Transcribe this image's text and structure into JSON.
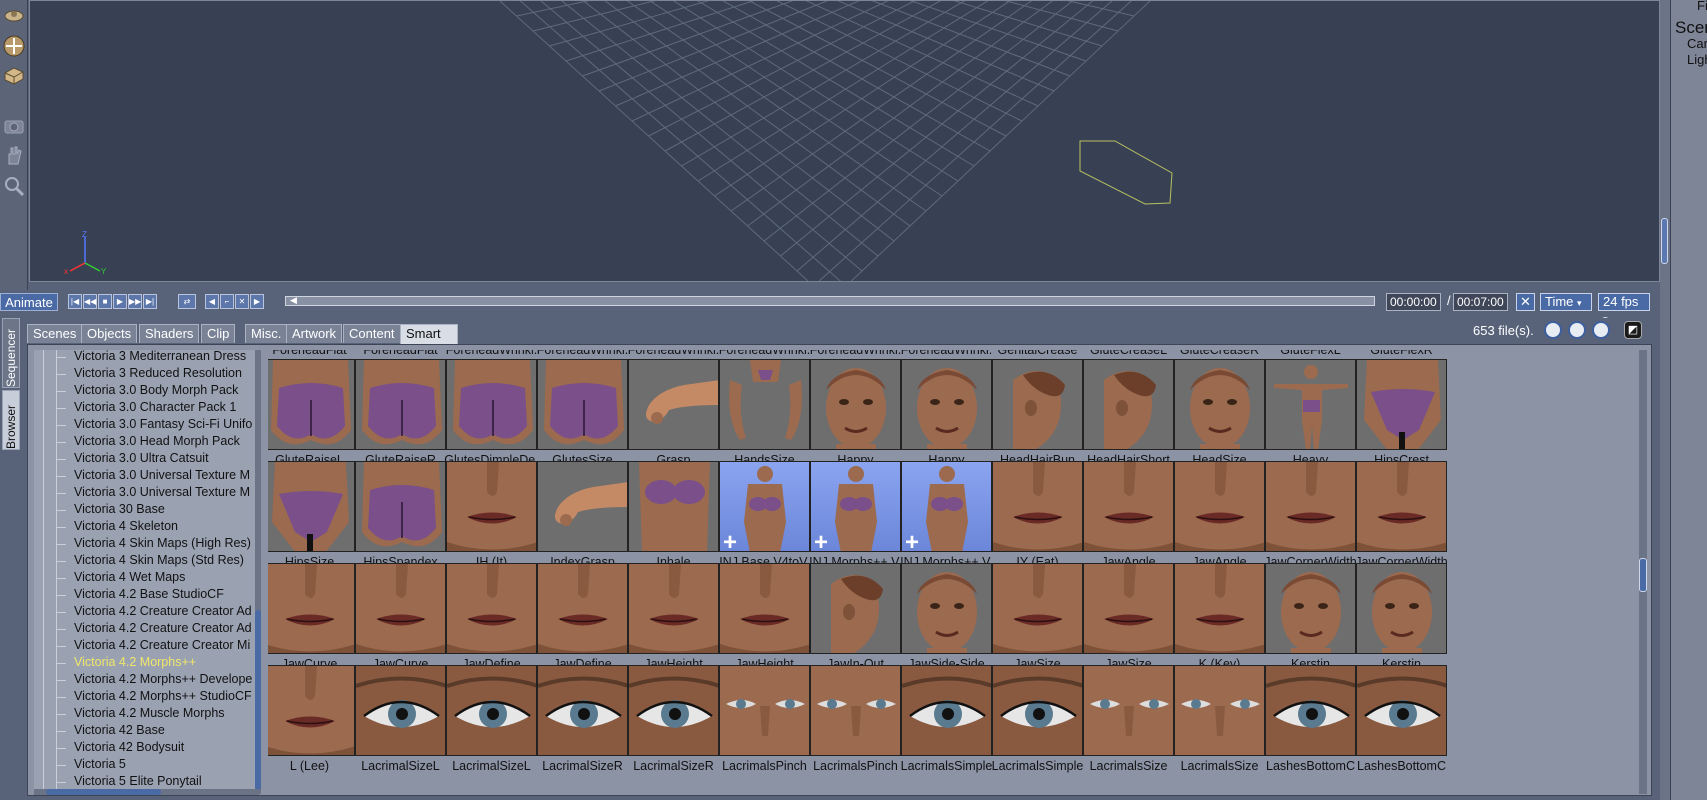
{
  "app": {
    "right_panel": {
      "items": [
        "Fi",
        "Scen",
        "Car",
        "Ligh"
      ]
    }
  },
  "animbar": {
    "animate_label": "Animate",
    "time_current": "00:00:00",
    "time_total": "00:07:00",
    "time_separator": "/",
    "time_mode": "Time",
    "fps": "24 fps"
  },
  "side_tabs": [
    "Sequencer",
    "Browser"
  ],
  "tabs": [
    "Scenes",
    "Objects",
    "Shaders",
    "Clip",
    "Misc.",
    "Artwork",
    "Content",
    "Smart Content"
  ],
  "active_tab": "Smart Content",
  "file_count": "653 file(s).",
  "tree": {
    "items": [
      "Victoria 3 Mediterranean Dress",
      "Victoria 3 Reduced Resolution",
      "Victoria 3.0 Body Morph Pack",
      "Victoria 3.0 Character Pack 1",
      "Victoria 3.0 Fantasy Sci-Fi Unifo",
      "Victoria 3.0 Head Morph Pack",
      "Victoria 3.0 Ultra Catsuit",
      "Victoria 3.0 Universal Texture M",
      "Victoria 3.0 Universal Texture M",
      "Victoria 30 Base",
      "Victoria 4 Skeleton",
      "Victoria 4 Skin Maps (High Res)",
      "Victoria 4 Skin Maps (Std Res)",
      "Victoria 4 Wet Maps",
      "Victoria 4.2 Base StudioCF",
      "Victoria 4.2 Creature Creator Ad",
      "Victoria 4.2 Creature Creator Ad",
      "Victoria 4.2 Creature Creator Mi",
      "Victoria 4.2 Morphs++",
      "Victoria 4.2 Morphs++ Develope",
      "Victoria 4.2 Morphs++ StudioCF",
      "Victoria 4.2 Muscle Morphs",
      "Victoria 42 Base",
      "Victoria 42 Bodysuit",
      "Victoria 5",
      "Victoria 5 Elite Ponytail"
    ],
    "selected_index": 18
  },
  "grid": {
    "top_partial_labels": [
      "ForeheadFlat",
      "ForeheadFlat",
      "ForeheadWrinkl.",
      "ForeheadWrinkl.",
      "ForeheadWrinkl.",
      "ForeheadWrinkl.",
      "ForeheadWrinkl.",
      "ForeheadWrinkl.",
      "GenitalCrease",
      "GluteCreaseL",
      "GluteCreaseR",
      "GluteFlexL",
      "GluteFlexR"
    ],
    "rows": [
      [
        {
          "label": "GluteRaiseL",
          "kind": "glute"
        },
        {
          "label": "GluteRaiseR",
          "kind": "glute"
        },
        {
          "label": "GlutesDimpleDe.",
          "kind": "glute"
        },
        {
          "label": "GlutesSize",
          "kind": "glute"
        },
        {
          "label": "Grasp",
          "kind": "hand"
        },
        {
          "label": "HandsSize",
          "kind": "hands"
        },
        {
          "label": "Happy",
          "kind": "face"
        },
        {
          "label": "Happy",
          "kind": "face"
        },
        {
          "label": "HeadHairBun",
          "kind": "profile"
        },
        {
          "label": "HeadHairShort",
          "kind": "profile"
        },
        {
          "label": "HeadSize",
          "kind": "face"
        },
        {
          "label": "Heavy",
          "kind": "body"
        },
        {
          "label": "HipsCrest",
          "kind": "hips"
        }
      ],
      [
        {
          "label": "HipsSize",
          "kind": "hips"
        },
        {
          "label": "HipsSpandex",
          "kind": "glute"
        },
        {
          "label": "IH (It)",
          "kind": "mouth"
        },
        {
          "label": "IndexGrasp",
          "kind": "hand"
        },
        {
          "label": "Inhale",
          "kind": "torso"
        },
        {
          "label": "INJ Base V4toV.",
          "kind": "inj"
        },
        {
          "label": "INJ Morphs++ V.",
          "kind": "inj"
        },
        {
          "label": "INJ Morphs++ V.",
          "kind": "inj"
        },
        {
          "label": "IY (Eat)",
          "kind": "mouth"
        },
        {
          "label": "JawAngle",
          "kind": "mouth"
        },
        {
          "label": "JawAngle",
          "kind": "mouth"
        },
        {
          "label": "JawCornerWidth",
          "kind": "mouth"
        },
        {
          "label": "JawCornerWidth",
          "kind": "mouth"
        }
      ],
      [
        {
          "label": "JawCurve",
          "kind": "mouth"
        },
        {
          "label": "JawCurve",
          "kind": "mouth"
        },
        {
          "label": "JawDefine",
          "kind": "mouth"
        },
        {
          "label": "JawDefine",
          "kind": "mouth"
        },
        {
          "label": "JawHeight",
          "kind": "mouth"
        },
        {
          "label": "JawHeight",
          "kind": "mouth"
        },
        {
          "label": "JawIn-Out",
          "kind": "profile"
        },
        {
          "label": "JawSide-Side",
          "kind": "face"
        },
        {
          "label": "JawSize",
          "kind": "mouth"
        },
        {
          "label": "JawSize",
          "kind": "mouth"
        },
        {
          "label": "K (Key)",
          "kind": "mouth"
        },
        {
          "label": "Kerstin",
          "kind": "face"
        },
        {
          "label": "Kerstin",
          "kind": "face"
        }
      ],
      [
        {
          "label": "L (Lee)",
          "kind": "mouth"
        },
        {
          "label": "LacrimalSizeL",
          "kind": "eye"
        },
        {
          "label": "LacrimalSizeL",
          "kind": "eye"
        },
        {
          "label": "LacrimalSizeR",
          "kind": "eye"
        },
        {
          "label": "LacrimalSizeR",
          "kind": "eye"
        },
        {
          "label": "LacrimalsPinch",
          "kind": "eyes"
        },
        {
          "label": "LacrimalsPinch",
          "kind": "eyes"
        },
        {
          "label": "LacrimalsSimple",
          "kind": "eye"
        },
        {
          "label": "LacrimalsSimple",
          "kind": "eye"
        },
        {
          "label": "LacrimalsSize",
          "kind": "eyes"
        },
        {
          "label": "LacrimalsSize",
          "kind": "eyes"
        },
        {
          "label": "LashesBottomC",
          "kind": "eye"
        },
        {
          "label": "LashesBottomC",
          "kind": "eye"
        }
      ]
    ]
  },
  "colors": {
    "viewport_bg": "#374153",
    "accent": "#4a6aa6",
    "selected_tree_text": "#f0e66a",
    "inj_thumb": "#7f9bea"
  }
}
